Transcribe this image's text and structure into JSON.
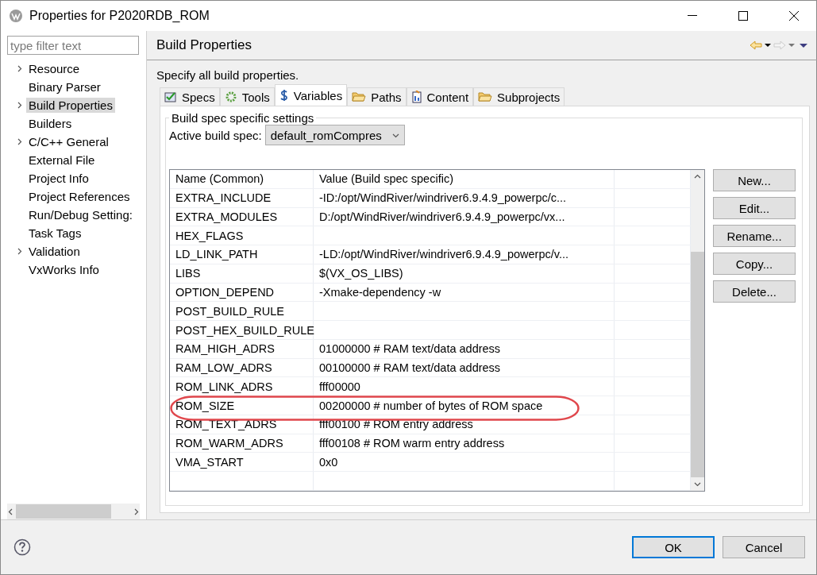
{
  "window": {
    "title": "Properties for P2020RDB_ROM"
  },
  "sidebar": {
    "filter": {
      "placeholder": "type filter text"
    },
    "items": [
      {
        "label": "Resource",
        "expandable": true,
        "selected": false
      },
      {
        "label": "Binary Parser",
        "expandable": false,
        "selected": false
      },
      {
        "label": "Build Properties",
        "expandable": true,
        "selected": true
      },
      {
        "label": "Builders",
        "expandable": false,
        "selected": false
      },
      {
        "label": "C/C++ General",
        "expandable": true,
        "selected": false
      },
      {
        "label": "External File",
        "expandable": false,
        "selected": false
      },
      {
        "label": "Project Info",
        "expandable": false,
        "selected": false
      },
      {
        "label": "Project References",
        "expandable": false,
        "selected": false
      },
      {
        "label": "Run/Debug Setting:",
        "expandable": false,
        "selected": false
      },
      {
        "label": "Task Tags",
        "expandable": false,
        "selected": false
      },
      {
        "label": "Validation",
        "expandable": true,
        "selected": false
      },
      {
        "label": "VxWorks Info",
        "expandable": false,
        "selected": false
      }
    ]
  },
  "page": {
    "title": "Build Properties",
    "description": "Specify all build properties.",
    "tabs": [
      {
        "label": "Specs",
        "kind": "specs",
        "selected": false
      },
      {
        "label": "Tools",
        "kind": "tools",
        "selected": false
      },
      {
        "label": "Variables",
        "kind": "variables",
        "selected": true
      },
      {
        "label": "Paths",
        "kind": "folder",
        "selected": false
      },
      {
        "label": "Content",
        "kind": "content",
        "selected": false
      },
      {
        "label": "Subprojects",
        "kind": "folder",
        "selected": false
      }
    ],
    "group": {
      "title": "Build spec specific settings",
      "active_build_spec": {
        "label": "Active build spec:",
        "value": "default_romCompres"
      }
    },
    "table": {
      "columns": [
        "Name (Common)",
        "Value (Build spec specific)"
      ],
      "rows": [
        {
          "name": "EXTRA_INCLUDE",
          "value": "-ID:/opt/WindRiver/windriver6.9.4.9_powerpc/c...",
          "circled": false
        },
        {
          "name": "EXTRA_MODULES",
          "value": "D:/opt/WindRiver/windriver6.9.4.9_powerpc/vx...",
          "circled": false
        },
        {
          "name": "HEX_FLAGS",
          "circled": false
        },
        {
          "name": "LD_LINK_PATH",
          "value": "-LD:/opt/WindRiver/windriver6.9.4.9_powerpc/v...",
          "circled": false
        },
        {
          "name": "LIBS",
          "value": "$(VX_OS_LIBS)",
          "circled": false
        },
        {
          "name": "OPTION_DEPEND",
          "value": "-Xmake-dependency -w",
          "circled": false
        },
        {
          "name": "POST_BUILD_RULE",
          "circled": false
        },
        {
          "name": "POST_HEX_BUILD_RULE",
          "circled": false
        },
        {
          "name": "RAM_HIGH_ADRS",
          "value": "01000000 # RAM text/data address",
          "circled": false
        },
        {
          "name": "RAM_LOW_ADRS",
          "value": "00100000 # RAM text/data address",
          "circled": false
        },
        {
          "name": "ROM_LINK_ADRS",
          "value": "fff00000",
          "circled": false
        },
        {
          "name": "ROM_SIZE",
          "value": "00200000 # number of bytes of ROM space",
          "circled": true
        },
        {
          "name": "ROM_TEXT_ADRS",
          "value": "fff00100 # ROM entry address",
          "circled": false
        },
        {
          "name": "ROM_WARM_ADRS",
          "value": "fff00108 # ROM warm entry address",
          "circled": false
        },
        {
          "name": "VMA_START",
          "value": "0x0",
          "circled": false
        }
      ]
    },
    "buttons": [
      "New...",
      "Edit...",
      "Rename...",
      "Copy...",
      "Delete..."
    ]
  },
  "footer": {
    "buttons": [
      {
        "label": "OK",
        "default": true
      },
      {
        "label": "Cancel",
        "default": false
      }
    ]
  }
}
